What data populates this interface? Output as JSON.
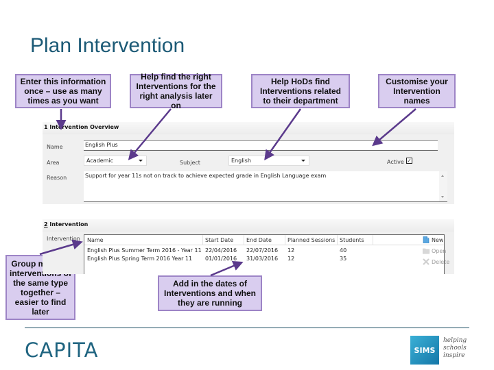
{
  "slide": {
    "title": "Plan Intervention"
  },
  "callouts": {
    "enter_info": "Enter this information once – use as many times as you want",
    "help_find": "Help find the right Interventions for the right analysis later on",
    "help_hods": "Help HoDs find Interventions related to their department",
    "customise": "Customise your Intervention names",
    "group_multiple": "Group multiple interventions of the same type together – easier to find later",
    "add_dates": "Add in the dates of Interventions and when they are running"
  },
  "overview": {
    "header": "1 Intervention Overview",
    "name_label": "Name",
    "name_value": "English Plus",
    "area_label": "Area",
    "area_value": "Academic",
    "subject_label": "Subject",
    "subject_value": "English",
    "active_label": "Active",
    "active_checked": true,
    "active_mark": "✓",
    "reason_label": "Reason",
    "reason_value": "Support for year 11s not on track to achieve expected grade in English Language exam"
  },
  "intervention": {
    "header": "2 Intervention",
    "list_label": "Intervention",
    "columns": [
      "Name",
      "Start Date",
      "End Date",
      "Planned Sessions",
      "Students"
    ],
    "rows": [
      [
        "English Plus Summer Term 2016 - Year 11",
        "22/04/2016",
        "22/07/2016",
        "12",
        "40"
      ],
      [
        "English Plus Spring Term 2016 Year 11",
        "01/01/2016",
        "31/03/2016",
        "12",
        "35"
      ]
    ],
    "actions": [
      {
        "label": "New",
        "icon": "new-document-icon",
        "enabled": true
      },
      {
        "label": "Open",
        "icon": "open-folder-icon",
        "enabled": false
      },
      {
        "label": "Delete",
        "icon": "delete-x-icon",
        "enabled": false
      }
    ]
  },
  "footer": {
    "brand": "CAPITA",
    "sims_logo": "SIMS",
    "tagline": [
      "helping",
      "schools",
      "inspire"
    ]
  },
  "colors": {
    "title": "#1c5a76",
    "callout_bg": "#d9cdef",
    "callout_border": "#9d84c6",
    "arrow": "#5b3a8c",
    "capita": "#1f6480",
    "sims": "#2a96c4"
  }
}
